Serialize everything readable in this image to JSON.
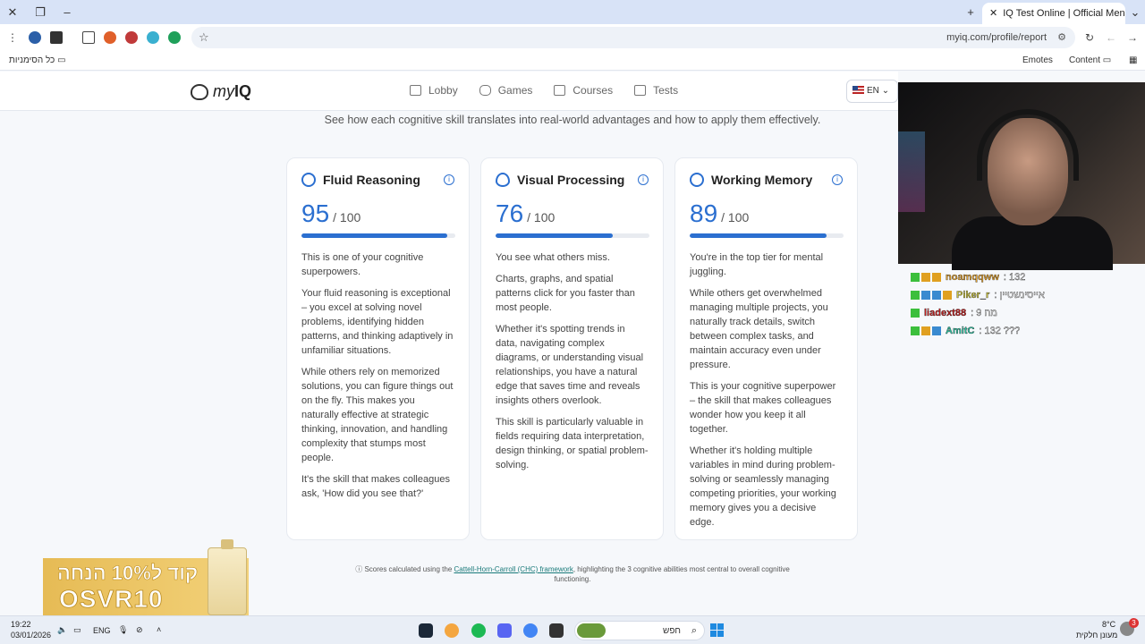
{
  "browser": {
    "tab_title": "IQ Test Online | Official Mensa",
    "url": "myiq.com/profile/report",
    "bookmarks_all": "כל הסימניות",
    "bookmark_emotes": "Emotes",
    "bookmark_content": "Content"
  },
  "site": {
    "logo_text_a": "my",
    "logo_text_b": "IQ",
    "nav": [
      "Lobby",
      "Games",
      "Courses",
      "Tests"
    ],
    "lang": "EN"
  },
  "page": {
    "subtitle": "See how each cognitive skill translates into real-world advantages and how to apply them effectively.",
    "cards": [
      {
        "title": "Fluid Reasoning",
        "score": "95",
        "max": "/ 100",
        "progress_percent": 95,
        "icon": "puzzle-icon",
        "paragraphs": [
          "This is one of your cognitive superpowers.",
          "Your fluid reasoning is exceptional – you excel at solving novel problems, identifying hidden patterns, and thinking adaptively in unfamiliar situations.",
          "While others rely on memorized solutions, you can figure things out on the fly. This makes you naturally effective at strategic thinking, innovation, and handling complexity that stumps most people.",
          "It's the skill that makes colleagues ask, 'How did you see that?'"
        ]
      },
      {
        "title": "Visual Processing",
        "score": "76",
        "max": "/ 100",
        "progress_percent": 76,
        "icon": "eye-icon",
        "paragraphs": [
          "You see what others miss.",
          "Charts, graphs, and spatial patterns click for you faster than most people.",
          "Whether it's spotting trends in data, navigating complex diagrams, or understanding visual relationships, you have a natural edge that saves time and reveals insights others overlook.",
          "This skill is particularly valuable in fields requiring data interpretation, design thinking, or spatial problem-solving."
        ]
      },
      {
        "title": "Working Memory",
        "score": "89",
        "max": "/ 100",
        "progress_percent": 89,
        "icon": "brain-icon",
        "paragraphs": [
          "You're in the top tier for mental juggling.",
          "While others get overwhelmed managing multiple projects, you naturally track details, switch between complex tasks, and maintain accuracy even under pressure.",
          "This is your cognitive superpower – the skill that makes colleagues wonder how you keep it all together.",
          "Whether it's holding multiple variables in mind during problem-solving or seamlessly managing competing priorities, your working memory gives you a decisive edge."
        ]
      }
    ],
    "footnote_pre": "Scores calculated using the ",
    "footnote_link": "Cattell-Horn-Carroll (CHC) framework",
    "footnote_post": ", highlighting the 3 cognitive abilities most central to overall cognitive functioning."
  },
  "chat": [
    {
      "user": "noamqqww",
      "msg": ": 132",
      "color": "#e0a030"
    },
    {
      "user": "Piker_r",
      "msg": ": אייסינשטיין",
      "color": "#c8c040"
    },
    {
      "user": "liadext88",
      "msg": ": 9 מה",
      "color": "#c02020"
    },
    {
      "user": "AmitC",
      "msg": ": 132 ???",
      "color": "#30c0a0"
    }
  ],
  "promo": {
    "line1": "קוד ל10% הנחה",
    "line2": "OSVR10"
  },
  "taskbar": {
    "time": "19:22",
    "date": "03/01/2026",
    "lang": "ENG",
    "search_placeholder": "חפש",
    "weather_temp": "8°C",
    "weather_desc": "מעונן חלקית",
    "notif_count": "3"
  }
}
